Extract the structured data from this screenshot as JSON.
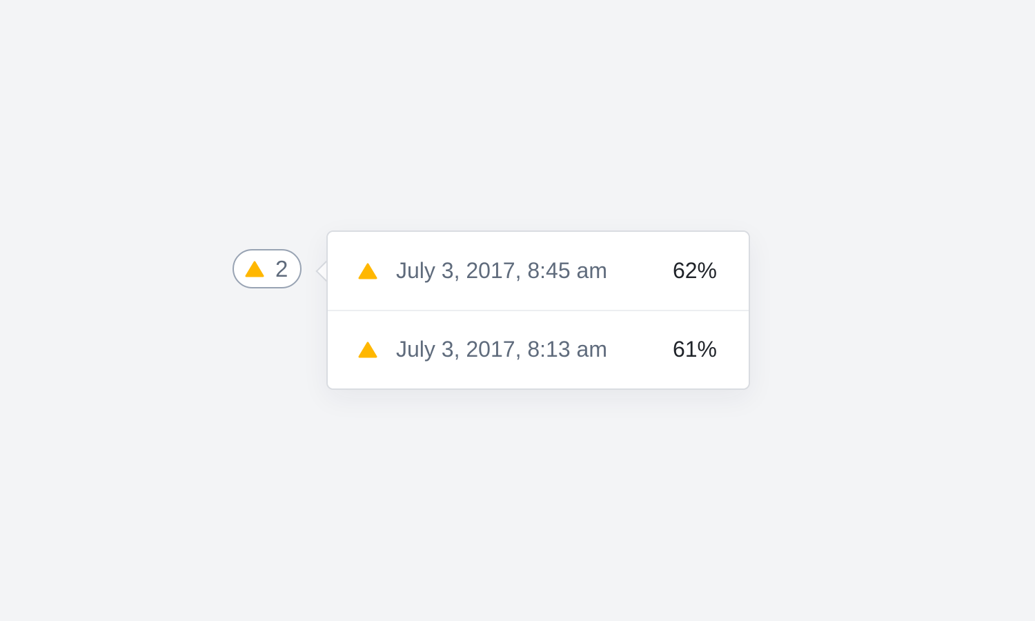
{
  "colors": {
    "background": "#f3f4f6",
    "warning": "#ffb700",
    "badge_border": "#98a3b3",
    "muted_text": "#5f6b7c",
    "strong_text": "#1f2329"
  },
  "badge": {
    "icon": "warning-triangle-icon",
    "count": "2"
  },
  "popover": {
    "items": [
      {
        "icon": "warning-triangle-icon",
        "timestamp": "July 3, 2017, 8:45 am",
        "percent": "62%"
      },
      {
        "icon": "warning-triangle-icon",
        "timestamp": "July 3, 2017, 8:13 am",
        "percent": "61%"
      }
    ]
  }
}
